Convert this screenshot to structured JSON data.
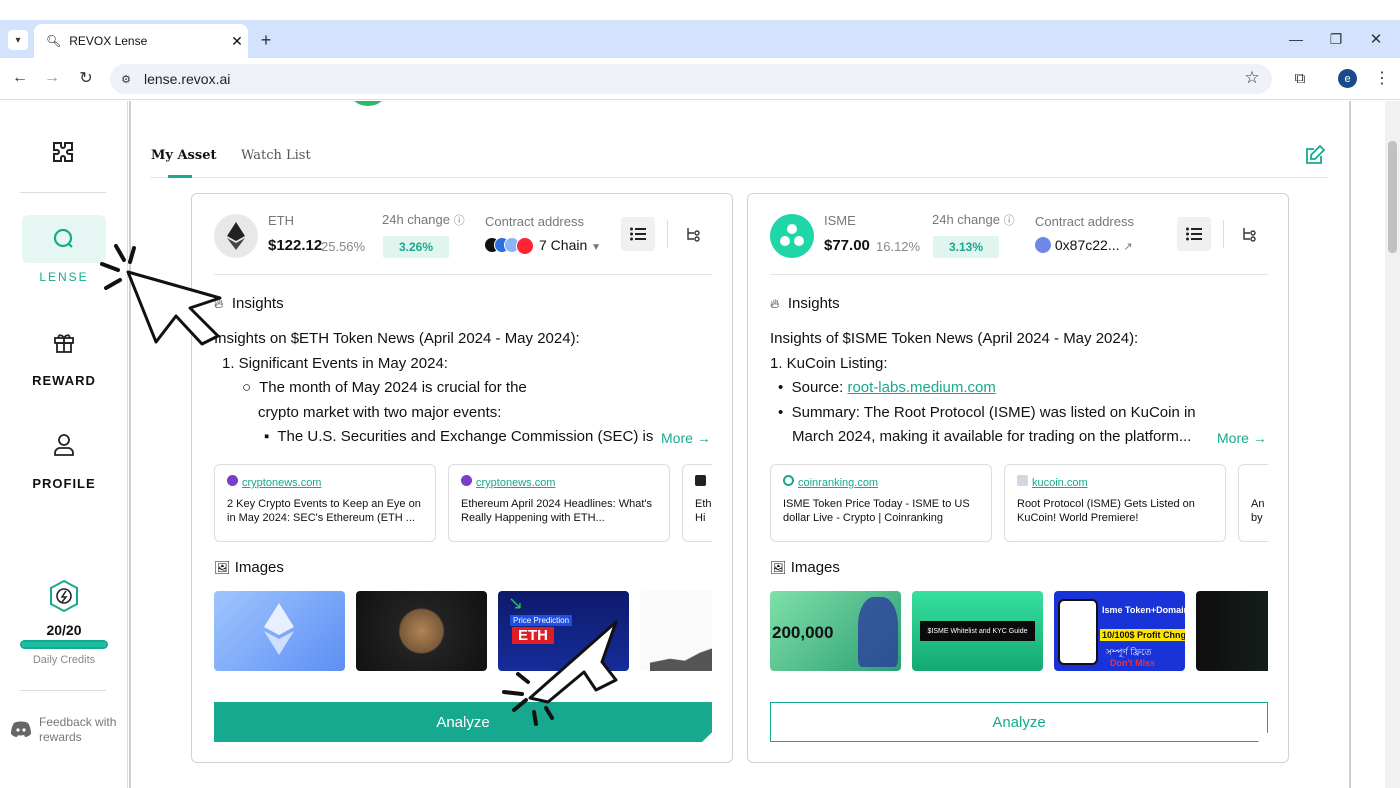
{
  "browser": {
    "tab_title": "REVOX Lense",
    "url": "lense.revox.ai",
    "profile_letter": "e"
  },
  "sidebar": {
    "items": [
      {
        "label": "LENSE"
      },
      {
        "label": "REWARD"
      },
      {
        "label": "PROFILE"
      }
    ],
    "credits_value": "20/20",
    "credits_label": "Daily Credits",
    "credits_fraction": 1.0,
    "feedback_line1": "Feedback with",
    "feedback_line2": "rewards"
  },
  "main": {
    "tabs": [
      {
        "label": "My Asset",
        "active": true
      },
      {
        "label": "Watch List",
        "active": false
      }
    ]
  },
  "cards": [
    {
      "symbol": "ETH",
      "price": "$122.12",
      "price_pct": "25.56%",
      "change_label": "24h change",
      "change_value": "3.26%",
      "contract_label": "Contract address",
      "contract_value": "7 Chain",
      "insights_title": "Insights",
      "insights_heading": "Insights on $ETH Token News (April 2024 - May 2024):",
      "insights_item1": "1. Significant Events in May 2024:",
      "insights_sub1": "The month of May 2024 is crucial for the",
      "insights_sub1b": "crypto market with two major events:",
      "insights_sub2": "The U.S. Securities and Exchange Commission (SEC) is ex",
      "more": "More →",
      "news": [
        {
          "source": "cryptonews.com",
          "title": "2 Key Crypto Events to Keep an Eye on in May 2024: SEC's Ethereum (ETH ..."
        },
        {
          "source": "cryptonews.com",
          "title": "Ethereum April 2024 Headlines: What's Really Happening with ETH..."
        },
        {
          "source": "",
          "title": "Eth Hi"
        }
      ],
      "images_title": "Images",
      "thumb_text_1": "Price Prediction",
      "thumb_text_2": "ETH",
      "analyze": "Analyze"
    },
    {
      "symbol": "ISME",
      "price": "$77.00",
      "price_pct": "16.12%",
      "change_label": "24h change",
      "change_value": "3.13%",
      "contract_label": "Contract address",
      "contract_value": "0x87c22...",
      "insights_title": "Insights",
      "insights_heading": "Insights of $ISME Token News (April 2024 - May 2024):",
      "insights_item1": "1. KuCoin Listing:",
      "source_label": "Source",
      "source_link": "root-labs.medium.com",
      "summary_label": "Summary",
      "summary_text": ": The Root Protocol (ISME) was listed on KuCoin in",
      "summary_text2": "March 2024, making it available for trading on the platform....",
      "more": "More →",
      "news": [
        {
          "source": "coinranking.com",
          "title": "ISME Token Price Today - ISME to US dollar Live - Crypto | Coinranking"
        },
        {
          "source": "kucoin.com",
          "title": "Root Protocol (ISME) Gets Listed on KuCoin! World Premiere!"
        },
        {
          "source": "",
          "title": "An by"
        }
      ],
      "images_title": "Images",
      "thumb_text_1": "200,000",
      "thumb_text_2": "$ISME Whitelist and KYC Guide",
      "thumb_text_3": "Isme Token+Domain",
      "thumb_text_4": "10/100$ Profit Chng",
      "thumb_text_5": "সম্পূর্ণ ফ্রিতে",
      "thumb_text_6": "Don't Miss",
      "analyze": "Analyze"
    }
  ],
  "colors": {
    "accent": "#17a98f",
    "accent_light": "#dff5ee",
    "tabbar": "#d3e3fd"
  }
}
